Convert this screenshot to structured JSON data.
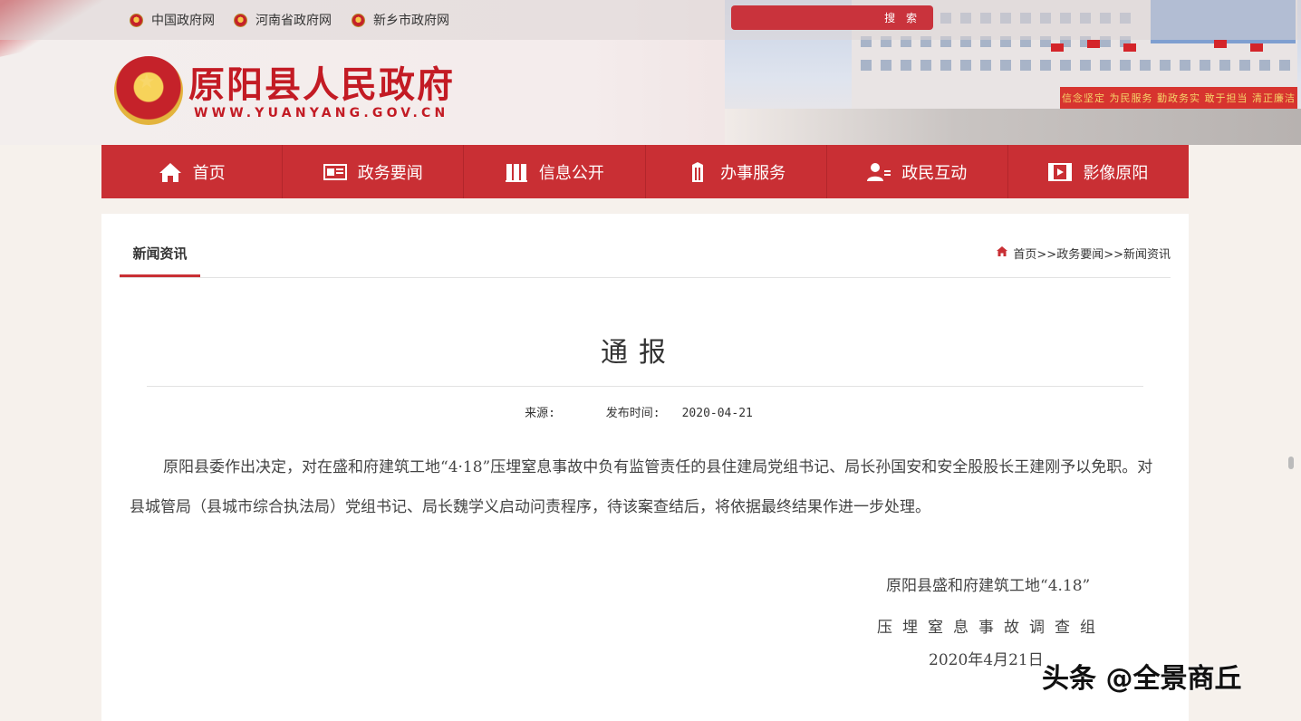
{
  "top_links": [
    {
      "label": "中国政府网"
    },
    {
      "label": "河南省政府网"
    },
    {
      "label": "新乡市政府网"
    }
  ],
  "search": {
    "button_label": "搜 索",
    "placeholder": ""
  },
  "header": {
    "site_title": "原阳县人民政府",
    "site_url": "WWW.YUANYANG.GOV.CN",
    "banner_slogan": "信念坚定 为民服务 勤政务实 敢于担当 清正廉洁"
  },
  "nav": {
    "items": [
      {
        "label": "首页",
        "icon": "home-icon"
      },
      {
        "label": "政务要闻",
        "icon": "news-icon"
      },
      {
        "label": "信息公开",
        "icon": "books-icon"
      },
      {
        "label": "办事服务",
        "icon": "building-icon"
      },
      {
        "label": "政民互动",
        "icon": "user-chat-icon"
      },
      {
        "label": "影像原阳",
        "icon": "film-icon"
      }
    ]
  },
  "section": {
    "tab_label": "新闻资讯",
    "breadcrumb": [
      "首页",
      ">>政务要闻",
      ">>新闻资讯"
    ]
  },
  "article": {
    "title": "通报",
    "source_label": "来源:",
    "source_value": "",
    "date_label": "发布时间:",
    "date_value": "2020-04-21",
    "body": "原阳县委作出决定，对在盛和府建筑工地“4·18”压埋窒息事故中负有监管责任的县住建局党组书记、局长孙国安和安全股股长王建刚予以免职。对县城管局（县城市综合执法局）党组书记、局长魏学义启动问责程序，待该案查结后，将依据最终结果作进一步处理。",
    "signature_line1": "原阳县盛和府建筑工地“4.18”",
    "signature_line2": "压埋窒息事故调查组",
    "signature_date": "2020年4月21日"
  },
  "watermark": "头条 @全景商丘",
  "colors": {
    "brand_red": "#c92f34",
    "title_red": "#c31b24",
    "page_bg": "#f6f1ec"
  }
}
